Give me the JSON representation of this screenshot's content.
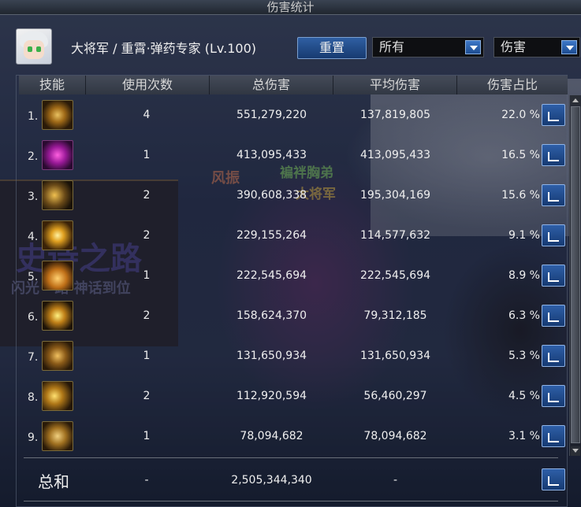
{
  "window": {
    "title": "伤害统计"
  },
  "character": {
    "name": "大将军 / 重霄·弹药专家 (Lv.100)"
  },
  "controls": {
    "reset_label": "重置",
    "filter_target": "所有",
    "filter_metric": "伤害"
  },
  "table": {
    "headers": [
      "技能",
      "使用次数",
      "总伤害",
      "平均伤害",
      "伤害占比"
    ],
    "rows": [
      {
        "index": "1.",
        "skill_icon": "golden-crown-skill-icon",
        "count": "4",
        "total": "551,279,220",
        "avg": "137,819,805",
        "pct": "22.0 %"
      },
      {
        "index": "2.",
        "skill_icon": "magenta-orb-skill-icon",
        "count": "1",
        "total": "413,095,433",
        "avg": "413,095,433",
        "pct": "16.5 %"
      },
      {
        "index": "3.",
        "skill_icon": "claw-slash-skill-icon",
        "count": "2",
        "total": "390,608,338",
        "avg": "195,304,169",
        "pct": "15.6 %"
      },
      {
        "index": "4.",
        "skill_icon": "starburst-skill-icon",
        "count": "2",
        "total": "229,155,264",
        "avg": "114,577,632",
        "pct": "9.1 %"
      },
      {
        "index": "5.",
        "skill_icon": "glowing-pot-skill-icon",
        "count": "1",
        "total": "222,545,694",
        "avg": "222,545,694",
        "pct": "8.9 %"
      },
      {
        "index": "6.",
        "skill_icon": "energy-wave-skill-icon",
        "count": "2",
        "total": "158,624,370",
        "avg": "79,312,185",
        "pct": "6.3 %"
      },
      {
        "index": "7.",
        "skill_icon": "shield-emblem-skill-icon",
        "count": "1",
        "total": "131,650,934",
        "avg": "131,650,934",
        "pct": "5.3 %"
      },
      {
        "index": "8.",
        "skill_icon": "arrow-shot-skill-icon",
        "count": "2",
        "total": "112,920,594",
        "avg": "56,460,297",
        "pct": "4.5 %"
      },
      {
        "index": "9.",
        "skill_icon": "grenade-skill-icon",
        "count": "1",
        "total": "78,094,682",
        "avg": "78,094,682",
        "pct": "3.1 %"
      }
    ]
  },
  "summary": {
    "label": "总和",
    "count": "-",
    "total": "2,505,344,340",
    "avg": "-"
  },
  "background_text": {
    "name1": "风振",
    "name2": "褊袢胸弟",
    "name3": "大将军",
    "promo1": "史诗之路",
    "promo2": "闪光 · 路 神话到位"
  }
}
